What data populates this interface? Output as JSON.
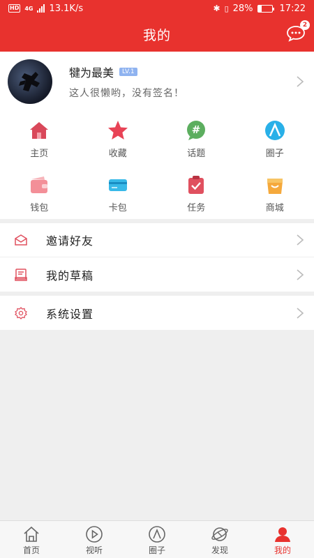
{
  "status": {
    "hd": "HD",
    "network": "4G",
    "speed": "13.1K/s",
    "battery": "28%",
    "time": "17:22"
  },
  "header": {
    "title": "我的",
    "message_badge": "2"
  },
  "profile": {
    "name": "犍为最美",
    "level": "LV.1",
    "signature": "这人很懒哟，没有签名！"
  },
  "grid": [
    {
      "label": "主页",
      "icon": "home-icon"
    },
    {
      "label": "收藏",
      "icon": "star-icon"
    },
    {
      "label": "话题",
      "icon": "topic-icon"
    },
    {
      "label": "圈子",
      "icon": "circle-icon"
    },
    {
      "label": "钱包",
      "icon": "wallet-icon"
    },
    {
      "label": "卡包",
      "icon": "card-icon"
    },
    {
      "label": "任务",
      "icon": "task-icon"
    },
    {
      "label": "商城",
      "icon": "mall-icon"
    }
  ],
  "menu1": [
    {
      "label": "邀请好友",
      "icon": "invite-icon"
    },
    {
      "label": "我的草稿",
      "icon": "draft-icon"
    }
  ],
  "menu2": [
    {
      "label": "系统设置",
      "icon": "settings-icon"
    }
  ],
  "tabs": [
    {
      "label": "首页",
      "icon": "home-tab-icon"
    },
    {
      "label": "视听",
      "icon": "play-icon"
    },
    {
      "label": "圈子",
      "icon": "circle-tab-icon"
    },
    {
      "label": "发现",
      "icon": "discover-icon"
    },
    {
      "label": "我的",
      "icon": "user-icon",
      "active": true
    }
  ],
  "colors": {
    "brand": "#e8322e",
    "background": "#efefef"
  }
}
